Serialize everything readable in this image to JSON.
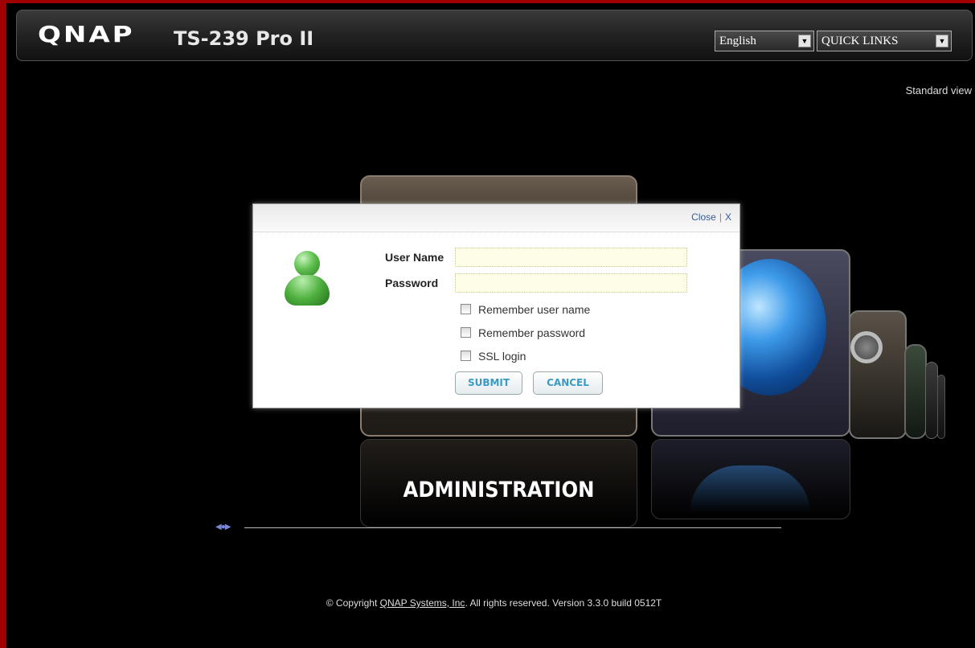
{
  "header": {
    "logo": "QNAP",
    "model": "TS-239 Pro II",
    "language_select": "English",
    "quick_links_select": "QUICK LINKS"
  },
  "standard_view": "Standard view",
  "carousel": {
    "current_label": "ADMINISTRATION",
    "slider_icon": "slider-arrows-icon"
  },
  "login": {
    "close_label": "Close",
    "separator": "|",
    "close_x": "X",
    "username_label": "User Name",
    "username_value": "",
    "password_label": "Password",
    "password_value": "",
    "remember_user": "Remember user name",
    "remember_password": "Remember password",
    "ssl_login": "SSL login",
    "submit": "SUBMIT",
    "cancel": "CANCEL"
  },
  "footer": {
    "prefix": "© Copyright ",
    "company": "QNAP Systems, Inc",
    "suffix": ". All rights reserved. Version 3.3.0 build 0512T"
  },
  "colors": {
    "frame_border": "#a00000",
    "link_blue": "#355a9a",
    "button_text": "#3a9ac4"
  }
}
